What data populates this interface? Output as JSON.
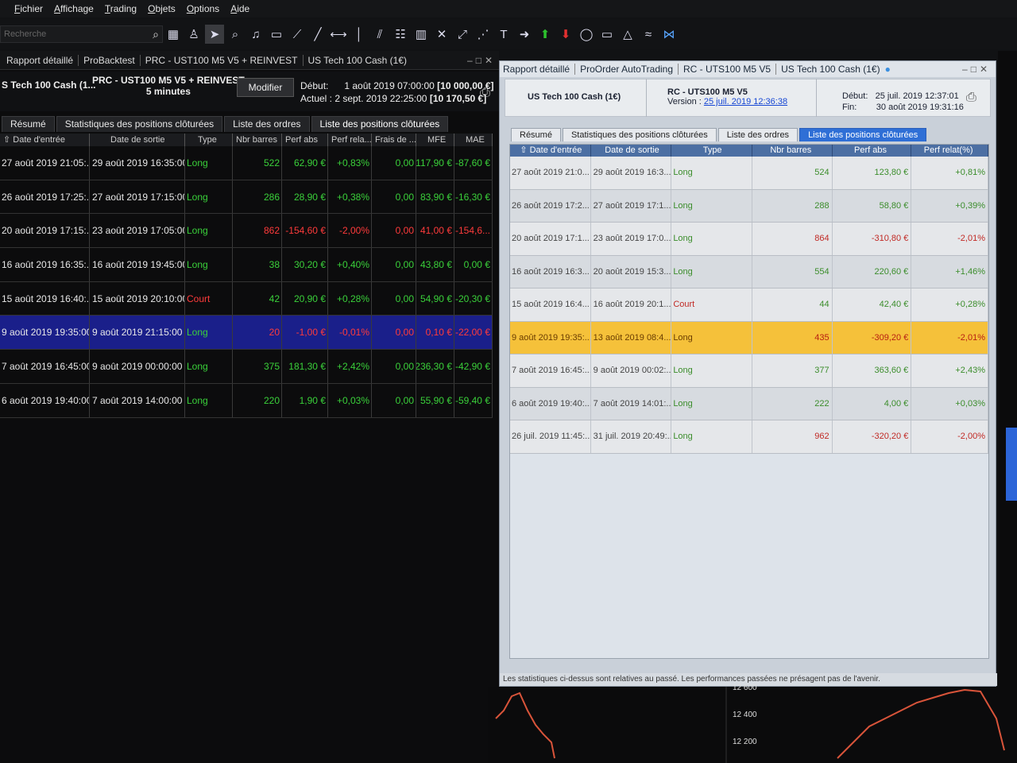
{
  "menu": [
    "Fichier",
    "Affichage",
    "Trading",
    "Objets",
    "Options",
    "Aide"
  ],
  "toolbar": {
    "search_placeholder": "Recherche"
  },
  "left": {
    "top_tabs": [
      "Rapport détaillé",
      "ProBacktest",
      "PRC - UST100 M5 V5 + REINVEST",
      "US Tech 100 Cash (1€)"
    ],
    "instrument": "S Tech 100 Cash (1...",
    "strategy": "PRC - UST100 M5 V5 + REINVEST",
    "timeframe": "5 minutes",
    "modify_label": "Modifier",
    "start_label": "Début:",
    "start_value": "1 août 2019 07:00:00",
    "start_capital": "[10 000,00 €]",
    "current_label": "Actuel :",
    "current_value": "2 sept. 2019 22:25:00",
    "current_capital": "[10 170,50 €]",
    "tabs": [
      "Résumé",
      "Statistiques des positions clôturées",
      "Liste des ordres",
      "Liste des positions clôturées"
    ],
    "columns": [
      "Date d'entrée",
      "Date de sortie",
      "Type",
      "Nbr barres",
      "Perf abs",
      "Perf rela...",
      "Frais de ...",
      "MFE",
      "MAE"
    ],
    "rows": [
      {
        "entry": "27 août 2019 21:05:...",
        "exit": "29 août 2019 16:35:00",
        "type": "Long",
        "bars": "522",
        "abs": "62,90 €",
        "rel": "+0,83%",
        "fees": "0,00",
        "mfe": "117,90 €",
        "mae": "-87,60 €"
      },
      {
        "entry": "26 août 2019 17:25:...",
        "exit": "27 août 2019 17:15:00",
        "type": "Long",
        "bars": "286",
        "abs": "28,90 €",
        "rel": "+0,38%",
        "fees": "0,00",
        "mfe": "83,90 €",
        "mae": "-16,30 €"
      },
      {
        "entry": "20 août 2019 17:15:...",
        "exit": "23 août 2019 17:05:00",
        "type": "Long",
        "bars": "862",
        "abs": "-154,60 €",
        "rel": "-2,00%",
        "fees": "0,00",
        "mfe": "41,00 €",
        "mae": "-154,6..."
      },
      {
        "entry": "16 août 2019 16:35:...",
        "exit": "16 août 2019 19:45:00",
        "type": "Long",
        "bars": "38",
        "abs": "30,20 €",
        "rel": "+0,40%",
        "fees": "0,00",
        "mfe": "43,80 €",
        "mae": "0,00 €"
      },
      {
        "entry": "15 août 2019 16:40:...",
        "exit": "15 août 2019 20:10:00",
        "type": "Court",
        "bars": "42",
        "abs": "20,90 €",
        "rel": "+0,28%",
        "fees": "0,00",
        "mfe": "54,90 €",
        "mae": "-20,30 €"
      },
      {
        "entry": "9 août 2019 19:35:00",
        "exit": "9 août 2019 21:15:00",
        "type": "Long",
        "bars": "20",
        "abs": "-1,00 €",
        "rel": "-0,01%",
        "fees": "0,00",
        "mfe": "0,10 €",
        "mae": "-22,00 €"
      },
      {
        "entry": "7 août 2019 16:45:00",
        "exit": "9 août 2019 00:00:00",
        "type": "Long",
        "bars": "375",
        "abs": "181,30 €",
        "rel": "+2,42%",
        "fees": "0,00",
        "mfe": "236,30 €",
        "mae": "-42,90 €"
      },
      {
        "entry": "6 août 2019 19:40:00",
        "exit": "7 août 2019 14:00:00",
        "type": "Long",
        "bars": "220",
        "abs": "1,90 €",
        "rel": "+0,03%",
        "fees": "0,00",
        "mfe": "55,90 €",
        "mae": "-59,40 €"
      }
    ]
  },
  "right": {
    "top_tabs": [
      "Rapport détaillé",
      "ProOrder AutoTrading",
      "RC - UTS100 M5 V5",
      "US Tech 100 Cash (1€)"
    ],
    "instrument": "US Tech 100 Cash (1€)",
    "strategy": "RC - UTS100 M5 V5",
    "version_label": "Version :",
    "version_value": "25 juil. 2019 12:36:38",
    "start_label": "Début:",
    "start_value": "25 juil. 2019 12:37:01",
    "end_label": "Fin:",
    "end_value": "30 août 2019 19:31:16",
    "tabs": [
      "Résumé",
      "Statistiques des positions clôturées",
      "Liste des ordres",
      "Liste des positions clôturées"
    ],
    "columns": [
      "Date d'entrée",
      "Date de sortie",
      "Type",
      "Nbr barres",
      "Perf abs",
      "Perf relat(%)"
    ],
    "rows": [
      {
        "entry": "27 août 2019 21:0...",
        "exit": "29 août 2019 16:3...",
        "type": "Long",
        "bars": "524",
        "abs": "123,80 €",
        "rel": "+0,81%"
      },
      {
        "entry": "26 août 2019 17:2...",
        "exit": "27 août 2019 17:1...",
        "type": "Long",
        "bars": "288",
        "abs": "58,80 €",
        "rel": "+0,39%"
      },
      {
        "entry": "20 août 2019 17:1...",
        "exit": "23 août 2019 17:0...",
        "type": "Long",
        "bars": "864",
        "abs": "-310,80 €",
        "rel": "-2,01%"
      },
      {
        "entry": "16 août 2019 16:3...",
        "exit": "20 août 2019 15:3...",
        "type": "Long",
        "bars": "554",
        "abs": "220,60 €",
        "rel": "+1,46%"
      },
      {
        "entry": "15 août 2019 16:4...",
        "exit": "16 août 2019 20:1...",
        "type": "Court",
        "bars": "44",
        "abs": "42,40 €",
        "rel": "+0,28%"
      },
      {
        "entry": "9 août 2019 19:35:...",
        "exit": "13 août 2019 08:4...",
        "type": "Long",
        "bars": "435",
        "abs": "-309,20 €",
        "rel": "-2,01%"
      },
      {
        "entry": "7 août 2019 16:45:...",
        "exit": "9 août 2019 00:02:...",
        "type": "Long",
        "bars": "377",
        "abs": "363,60 €",
        "rel": "+2,43%"
      },
      {
        "entry": "6 août 2019 19:40:...",
        "exit": "7 août 2019 14:01:...",
        "type": "Long",
        "bars": "222",
        "abs": "4,00 €",
        "rel": "+0,03%"
      },
      {
        "entry": "26 juil. 2019 11:45:...",
        "exit": "31 juil. 2019 20:49:...",
        "type": "Long",
        "bars": "962",
        "abs": "-320,20 €",
        "rel": "-2,00%"
      }
    ],
    "footer": "Les statistiques ci-dessus sont relatives au passé. Les performances passées ne présagent pas de l'avenir."
  },
  "chart": {
    "price_labels": [
      "12 600",
      "12 400",
      "12 200"
    ]
  },
  "colors": {
    "profit": "#3ad13a",
    "loss": "#ff3b3b",
    "selected_row_dark": "#1a1f8a",
    "selected_row_light": "#f5c13a",
    "active_tab": "#2f6fd6"
  }
}
